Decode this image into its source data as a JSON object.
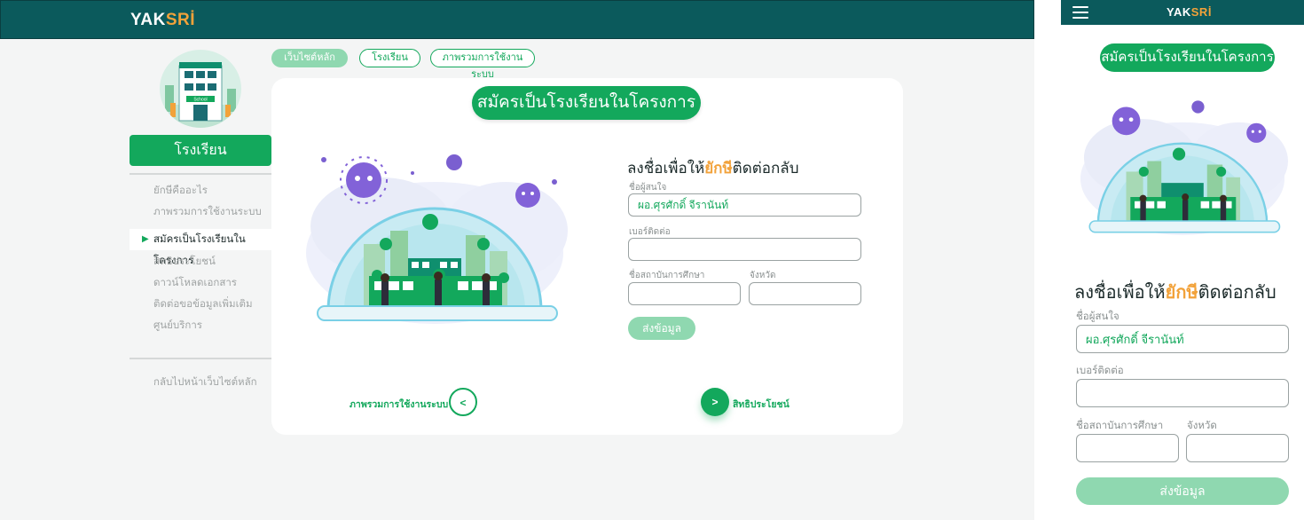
{
  "brand": {
    "logo_main": "YAK",
    "logo_accent": "SRİ"
  },
  "colors": {
    "header": "#0b5a5c",
    "primary": "#13a85c",
    "accent": "#f2a23a",
    "disabled": "#8fd8b0"
  },
  "sidebar": {
    "active_section": "โรงเรียน",
    "menu": [
      {
        "label": "ยักษีคืออะไร",
        "current": false
      },
      {
        "label": "ภาพรวมการใช้งานระบบ",
        "current": false
      },
      {
        "label": "สมัครเป็นโรงเรียนในโครงการ",
        "current": true
      },
      {
        "label": "สิทธิประโยชน์",
        "current": false
      },
      {
        "label": "ดาวน์โหลดเอกสาร",
        "current": false
      },
      {
        "label": "ติดต่อขอข้อมูลเพิ่มเติม",
        "current": false
      },
      {
        "label": "ศูนย์บริการ",
        "current": false
      }
    ],
    "back_link": "กลับไปหน้าเว็บไซต์หลัก",
    "illustration_text": "School"
  },
  "breadcrumb": [
    "เว็บไซต์หลัก",
    "โรงเรียน",
    "ภาพรวมการใช้งานระบบ"
  ],
  "page_title": "สมัครเป็นโรงเรียนในโครงการ",
  "form": {
    "heading_pre": "ลงชื่อเพื่อให้",
    "heading_highlight": "ยักษี",
    "heading_post": "ติดต่อกลับ",
    "name_label": "ชื่อผู้สนใจ",
    "name_value": "ผอ.ศุรศักดิ์ จีรานันท์",
    "phone_label": "เบอร์ติดต่อ",
    "phone_value": "",
    "school_label": "ชื่อสถาบันการศึกษา",
    "school_value": "",
    "province_label": "จังหวัด",
    "province_value": "",
    "submit_label": "ส่งข้อมูล"
  },
  "pager": {
    "prev_label": "ภาพรวมการใช้งานระบบ",
    "prev_symbol": "<",
    "next_label": "สิทธิประโยชน์",
    "next_symbol": ">"
  }
}
